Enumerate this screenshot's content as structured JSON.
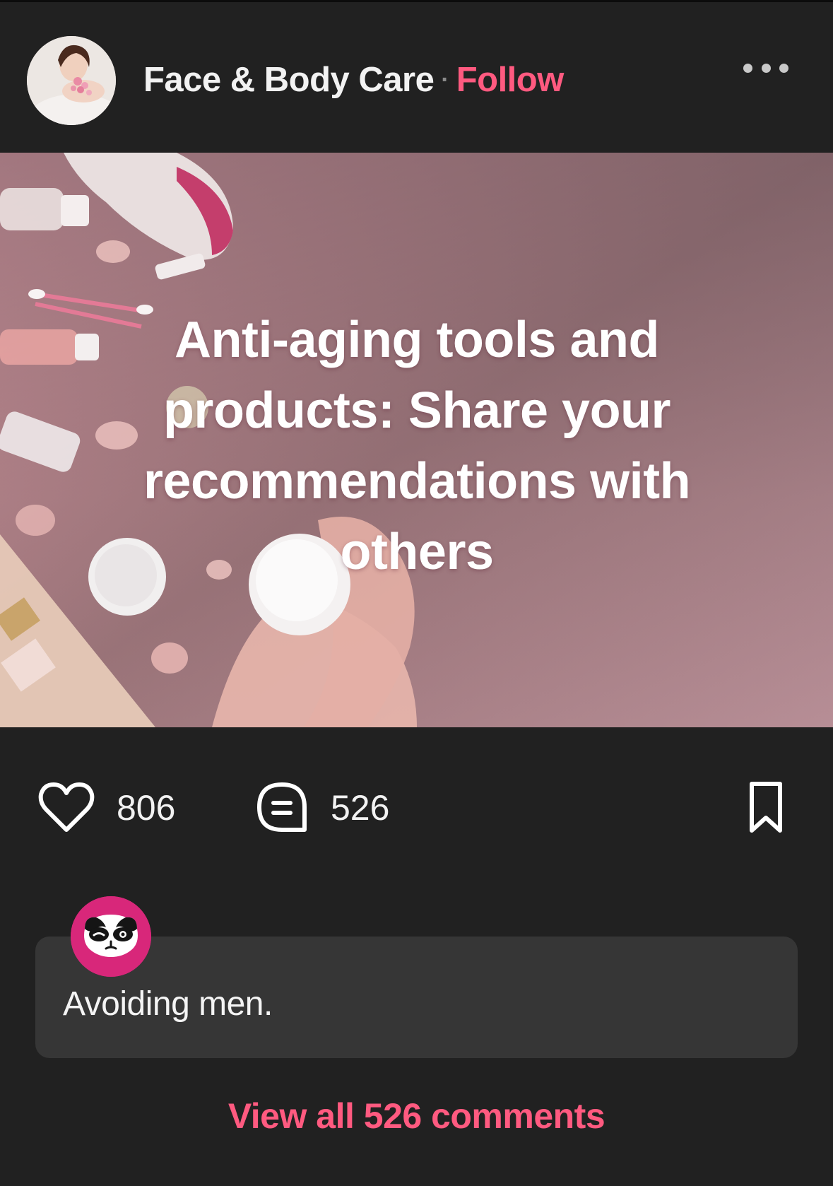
{
  "post": {
    "page_name": "Face & Body Care",
    "separator": "·",
    "follow_label": "Follow",
    "title": "Anti-aging tools and products: Share your recommendations with others"
  },
  "actions": {
    "likes": "806",
    "comments": "526"
  },
  "top_comment": {
    "text": "Avoiding men."
  },
  "view_all_label": "View all 526 comments",
  "colors": {
    "background": "#212121",
    "accent": "#ff5a80",
    "card": "#363636",
    "commenter_avatar": "#d8277a"
  },
  "icons": {
    "more": "more-horizontal-icon",
    "like": "heart-icon",
    "comment": "comment-bubble-icon",
    "save": "bookmark-icon"
  }
}
